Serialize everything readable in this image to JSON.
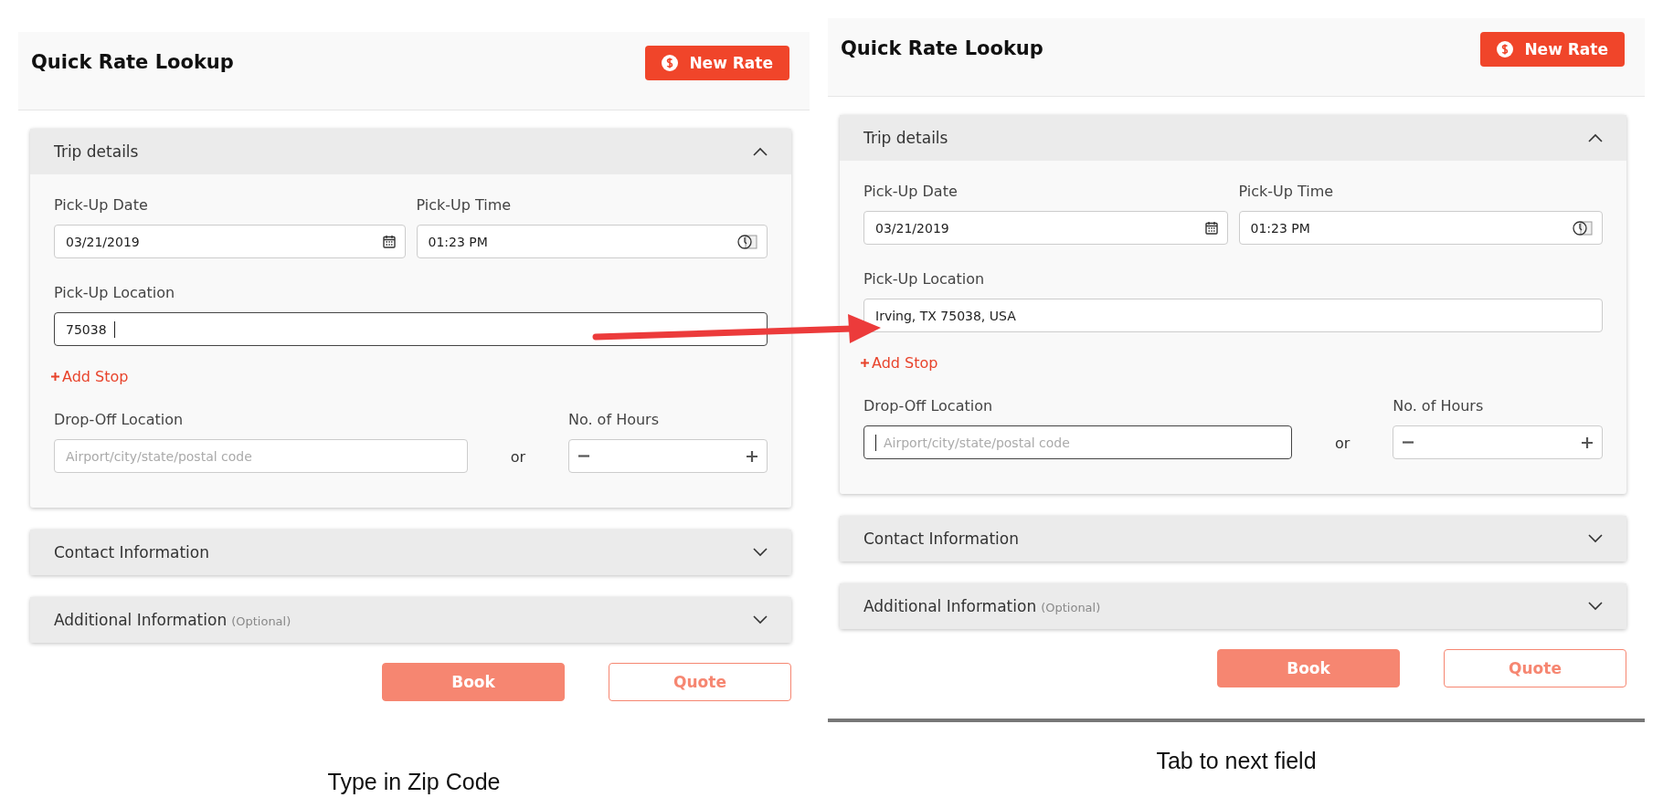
{
  "panels": [
    {
      "title": "Quick Rate Lookup",
      "new_rate": "New Rate",
      "trip": {
        "title": "Trip details",
        "expanded": true,
        "pickup_date": {
          "label": "Pick-Up Date",
          "value": "03/21/2019"
        },
        "pickup_time": {
          "label": "Pick-Up Time",
          "value": "01:23 PM"
        },
        "pickup_location": {
          "label": "Pick-Up Location",
          "value": "75038",
          "focused": true
        },
        "add_stop": "Add Stop",
        "dropoff_location": {
          "label": "Drop-Off Location",
          "placeholder": "Airport/city/state/postal code",
          "focused": false
        },
        "or": "or",
        "hours": {
          "label": "No. of Hours"
        }
      },
      "sections": [
        {
          "title": "Contact Information",
          "expanded": false
        },
        {
          "title": "Additional Information",
          "note": "(Optional)",
          "expanded": false
        }
      ],
      "buttons": [
        {
          "label": "Book",
          "kind": "primary"
        },
        {
          "label": "Quote",
          "kind": "outline"
        }
      ],
      "caption": "Type in Zip Code"
    },
    {
      "title": "Quick Rate Lookup",
      "new_rate": "New Rate",
      "trip": {
        "title": "Trip details",
        "expanded": true,
        "pickup_date": {
          "label": "Pick-Up Date",
          "value": "03/21/2019"
        },
        "pickup_time": {
          "label": "Pick-Up Time",
          "value": "01:23 PM"
        },
        "pickup_location": {
          "label": "Pick-Up Location",
          "value": "Irving, TX 75038, USA",
          "focused": false
        },
        "add_stop": "Add Stop",
        "dropoff_location": {
          "label": "Drop-Off Location",
          "placeholder": "Airport/city/state/postal code",
          "focused": true
        },
        "or": "or",
        "hours": {
          "label": "No. of Hours"
        }
      },
      "sections": [
        {
          "title": "Contact Information",
          "expanded": false
        },
        {
          "title": "Additional Information",
          "note": "(Optional)",
          "expanded": false
        }
      ],
      "buttons": [
        {
          "label": "Book",
          "kind": "primary"
        },
        {
          "label": "Quote",
          "kind": "outline"
        }
      ],
      "caption": "Tab to next field"
    }
  ]
}
